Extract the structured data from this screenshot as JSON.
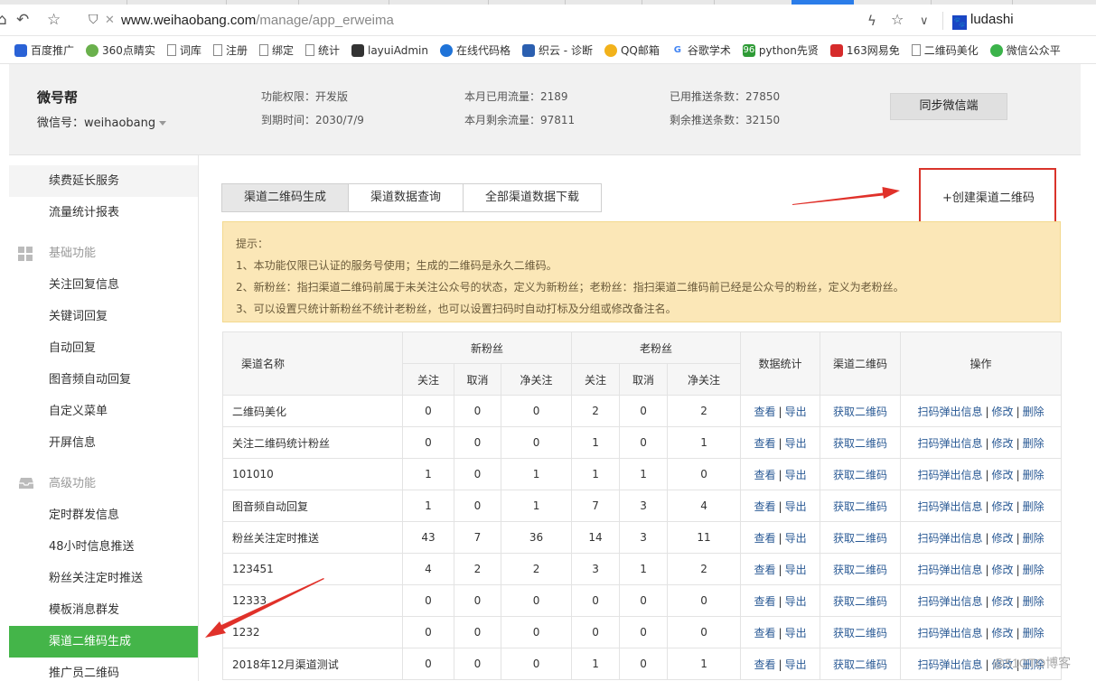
{
  "browser": {
    "url_host": "www.weihaobang.com",
    "url_path": "/manage/app_erweima",
    "profile": "ludashi",
    "bookmarks": [
      "百度推广",
      "360点睛实",
      "词库",
      "注册",
      "绑定",
      "统计",
      "layuiAdmin",
      "在线代码格",
      "织云 - 诊断",
      "QQ邮箱",
      "谷歌学术",
      "python先贤",
      "163网易免",
      "二维码美化",
      "微信公众平"
    ]
  },
  "header": {
    "brand": "微号帮",
    "wechat_id": "微信号：weihaobang",
    "perm": "功能权限：开发版",
    "expire": "到期时间：2030/7/9",
    "used_flow": "本月已用流量：2189",
    "remain_flow": "本月剩余流量：97811",
    "used_push": "已用推送条数：27850",
    "remain_push": "剩余推送条数：32150",
    "sync_button": "同步微信端"
  },
  "sidebar": {
    "items_top": [
      "续费延长服务",
      "流量统计报表"
    ],
    "group_basic": "基础功能",
    "items_basic": [
      "关注回复信息",
      "关键词回复",
      "自动回复",
      "图音频自动回复",
      "自定义菜单",
      "开屏信息"
    ],
    "group_advanced": "高级功能",
    "items_advanced": [
      "定时群发信息",
      "48小时信息推送",
      "粉丝关注定时推送",
      "模板消息群发",
      "渠道二维码生成",
      "推广员二维码"
    ],
    "active_item": "渠道二维码生成"
  },
  "tabs": [
    "渠道二维码生成",
    "渠道数据查询",
    "全部渠道数据下载"
  ],
  "create_button": "+创建渠道二维码",
  "notice": {
    "title": "提示：",
    "lines": [
      "1、本功能仅限已认证的服务号使用；生成的二维码是永久二维码。",
      "2、新粉丝：指扫渠道二维码前属于未关注公众号的状态，定义为新粉丝；老粉丝：指扫渠道二维码前已经是公众号的粉丝，定义为老粉丝。",
      "3、可以设置只统计新粉丝不统计老粉丝，也可以设置扫码时自动打标及分组或修改备注名。"
    ]
  },
  "table": {
    "col_name": "渠道名称",
    "col_new": "新粉丝",
    "col_old": "老粉丝",
    "col_stats": "数据统计",
    "col_qr": "渠道二维码",
    "col_ops": "操作",
    "sub": [
      "关注",
      "取消",
      "净关注"
    ],
    "view": "查看",
    "export": "导出",
    "get_qr": "获取二维码",
    "scan_info": "扫码弹出信息",
    "edit": "修改",
    "delete": "删除",
    "divider": "|",
    "rows": [
      {
        "name": "二维码美化",
        "n": [
          0,
          0,
          0
        ],
        "o": [
          2,
          0,
          2
        ]
      },
      {
        "name": "关注二维码统计粉丝",
        "n": [
          0,
          0,
          0
        ],
        "o": [
          1,
          0,
          1
        ]
      },
      {
        "name": "101010",
        "n": [
          1,
          0,
          1
        ],
        "o": [
          1,
          1,
          0
        ]
      },
      {
        "name": "图音频自动回复",
        "n": [
          1,
          0,
          1
        ],
        "o": [
          7,
          3,
          4
        ]
      },
      {
        "name": "粉丝关注定时推送",
        "n": [
          43,
          7,
          36
        ],
        "o": [
          14,
          3,
          11
        ]
      },
      {
        "name": "123451",
        "n": [
          4,
          2,
          2
        ],
        "o": [
          3,
          1,
          2
        ]
      },
      {
        "name": "12333",
        "n": [
          0,
          0,
          0
        ],
        "o": [
          0,
          0,
          0
        ]
      },
      {
        "name": "1232",
        "n": [
          0,
          0,
          0
        ],
        "o": [
          0,
          0,
          0
        ]
      },
      {
        "name": "2018年12月渠道测试",
        "n": [
          0,
          0,
          0
        ],
        "o": [
          1,
          0,
          1
        ]
      }
    ]
  },
  "watermark": "@51CTO博客",
  "colors": {
    "active": "#44b549",
    "notice_bg": "#fbe7b7",
    "link": "#2a5a95",
    "arrow": "#e0312a"
  }
}
